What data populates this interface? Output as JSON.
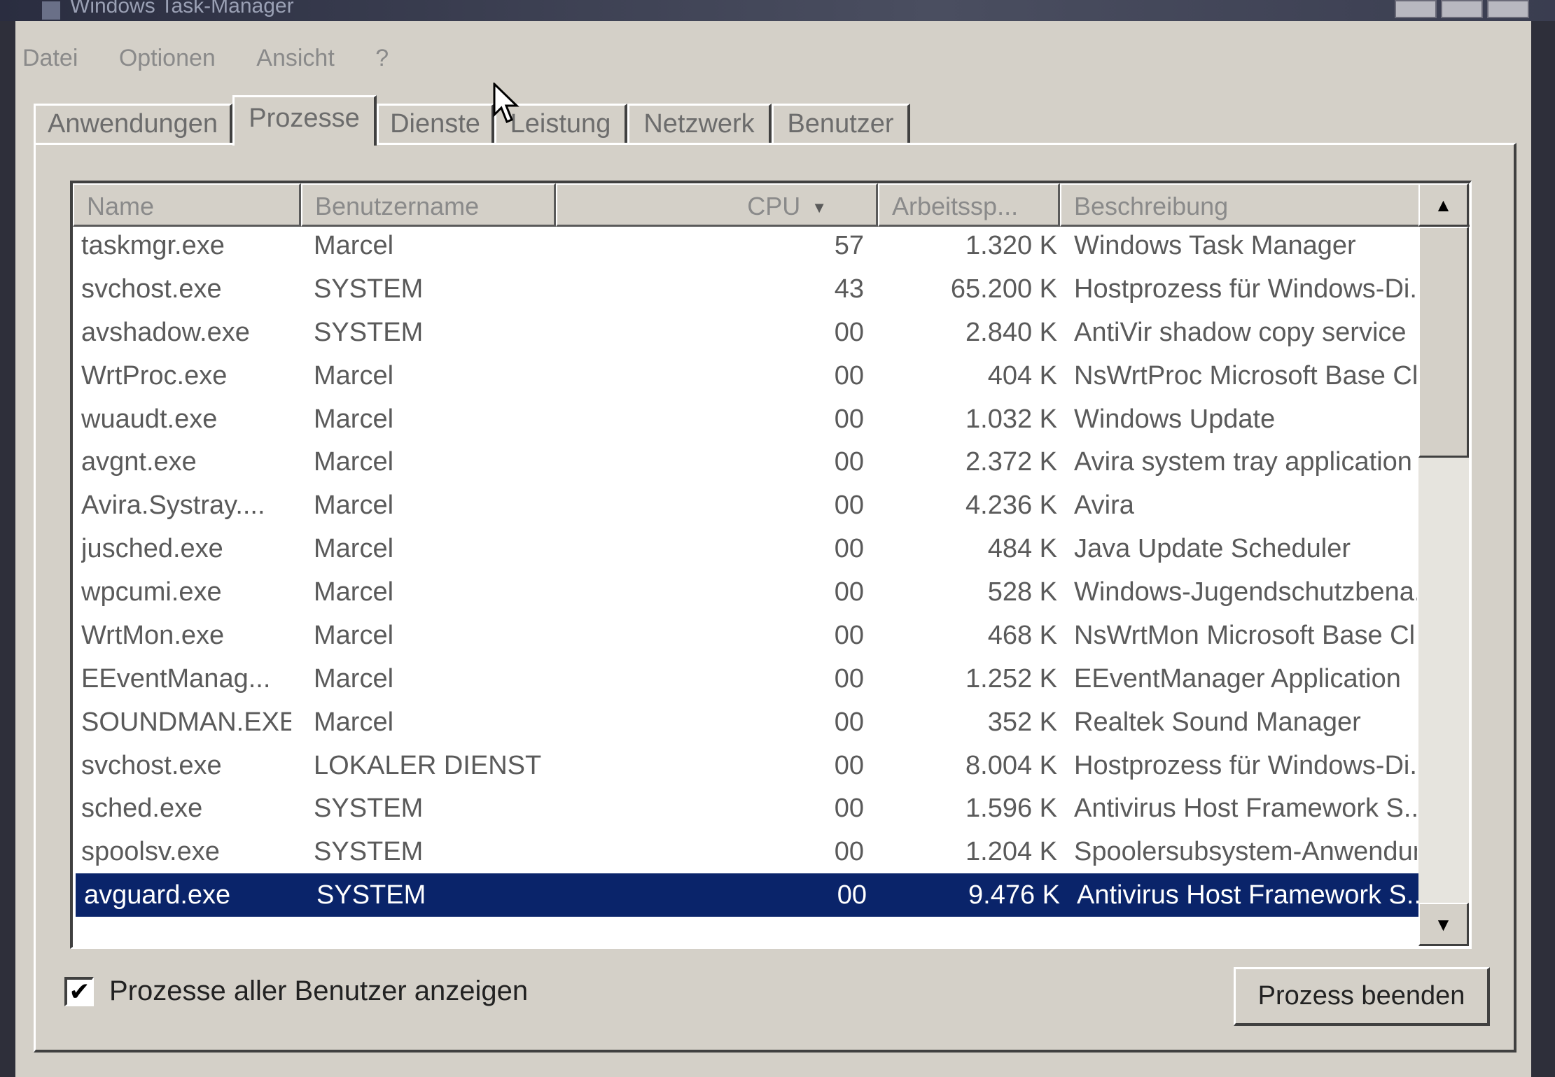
{
  "window": {
    "title": "Windows Task-Manager"
  },
  "menu": {
    "items": [
      "Datei",
      "Optionen",
      "Ansicht",
      "?"
    ]
  },
  "tabs": [
    "Anwendungen",
    "Prozesse",
    "Dienste",
    "Leistung",
    "Netzwerk",
    "Benutzer"
  ],
  "active_tab": "Prozesse",
  "table": {
    "columns": {
      "name": "Name",
      "user": "Benutzername",
      "cpu": "CPU",
      "mem": "Arbeitssp...",
      "desc": "Beschreibung"
    },
    "rows": [
      {
        "name": "taskmgr.exe",
        "user": "Marcel",
        "cpu": "57",
        "mem": "1.320 K",
        "desc": "Windows Task Manager"
      },
      {
        "name": "svchost.exe",
        "user": "SYSTEM",
        "cpu": "43",
        "mem": "65.200 K",
        "desc": "Hostprozess für Windows-Di..."
      },
      {
        "name": "avshadow.exe",
        "user": "SYSTEM",
        "cpu": "00",
        "mem": "2.840 K",
        "desc": "AntiVir shadow copy service"
      },
      {
        "name": "WrtProc.exe",
        "user": "Marcel",
        "cpu": "00",
        "mem": "404 K",
        "desc": "NsWrtProc Microsoft Base Cl..."
      },
      {
        "name": "wuaudt.exe",
        "user": "Marcel",
        "cpu": "00",
        "mem": "1.032 K",
        "desc": "Windows Update"
      },
      {
        "name": "avgnt.exe",
        "user": "Marcel",
        "cpu": "00",
        "mem": "2.372 K",
        "desc": "Avira system tray application"
      },
      {
        "name": "Avira.Systray....",
        "user": "Marcel",
        "cpu": "00",
        "mem": "4.236 K",
        "desc": "Avira"
      },
      {
        "name": "jusched.exe",
        "user": "Marcel",
        "cpu": "00",
        "mem": "484 K",
        "desc": "Java Update Scheduler"
      },
      {
        "name": "wpcumi.exe",
        "user": "Marcel",
        "cpu": "00",
        "mem": "528 K",
        "desc": "Windows-Jugendschutzbena..."
      },
      {
        "name": "WrtMon.exe",
        "user": "Marcel",
        "cpu": "00",
        "mem": "468 K",
        "desc": "NsWrtMon Microsoft Base Cl..."
      },
      {
        "name": "EEventManag...",
        "user": "Marcel",
        "cpu": "00",
        "mem": "1.252 K",
        "desc": "EEventManager Application"
      },
      {
        "name": "SOUNDMAN.EXE",
        "user": "Marcel",
        "cpu": "00",
        "mem": "352 K",
        "desc": "Realtek Sound Manager"
      },
      {
        "name": "svchost.exe",
        "user": "LOKALER DIENST",
        "cpu": "00",
        "mem": "8.004 K",
        "desc": "Hostprozess für Windows-Di..."
      },
      {
        "name": "sched.exe",
        "user": "SYSTEM",
        "cpu": "00",
        "mem": "1.596 K",
        "desc": "Antivirus Host Framework S..."
      },
      {
        "name": "spoolsv.exe",
        "user": "SYSTEM",
        "cpu": "00",
        "mem": "1.204 K",
        "desc": "Spoolersubsystem-Anwendung"
      },
      {
        "name": "avguard.exe",
        "user": "SYSTEM",
        "cpu": "00",
        "mem": "9.476 K",
        "desc": "Antivirus Host Framework S...",
        "selected": true
      }
    ]
  },
  "options": {
    "show_all_label": "Prozesse aller Benutzer anzeigen",
    "show_all_checked": true
  },
  "buttons": {
    "end_process": "Prozess beenden"
  },
  "colors": {
    "selection": "#0a246a",
    "face": "#d4d0c8"
  },
  "icons": {
    "sort": "sort-down-icon",
    "scroll_up": "scroll-up-icon",
    "scroll_down": "scroll-down-icon",
    "check": "check-icon"
  }
}
